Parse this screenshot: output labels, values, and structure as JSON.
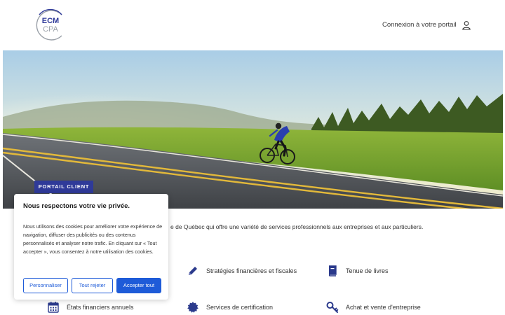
{
  "header": {
    "logo_line1": "ECM",
    "logo_line2": "CPA",
    "login_label": "Connexion à votre portail"
  },
  "hero": {
    "badge": "PORTAIL CLIENT"
  },
  "intro": {
    "text": "e de Québec qui offre une variété de services professionnels aux entreprises et aux particuliers."
  },
  "services": [
    {
      "label": "Stratégies financières et fiscales",
      "icon": "pencil-icon"
    },
    {
      "label": "Tenue de livres",
      "icon": "book-icon"
    },
    {
      "label": "États financiers annuels",
      "icon": "calendar-icon"
    },
    {
      "label": "Services de certification",
      "icon": "certificate-icon"
    },
    {
      "label": "Achat et vente d'entreprise",
      "icon": "key-icon"
    }
  ],
  "cookie": {
    "title": "Nous respectons votre vie privée.",
    "body": "Nous utilisons des cookies pour améliorer votre expérience de navigation, diffuser des publicités ou des contenus personnalisés et analyser notre trafic. En cliquant sur « Tout accepter », vous consentez à notre utilisation des cookies.",
    "customize_label": "Personnaliser",
    "reject_label": "Tout rejeter",
    "accept_label": "Accepter tout"
  },
  "colors": {
    "brand_navy": "#2f3a99",
    "icon_navy": "#2b3a8c",
    "accept_blue": "#1e5bd8"
  }
}
